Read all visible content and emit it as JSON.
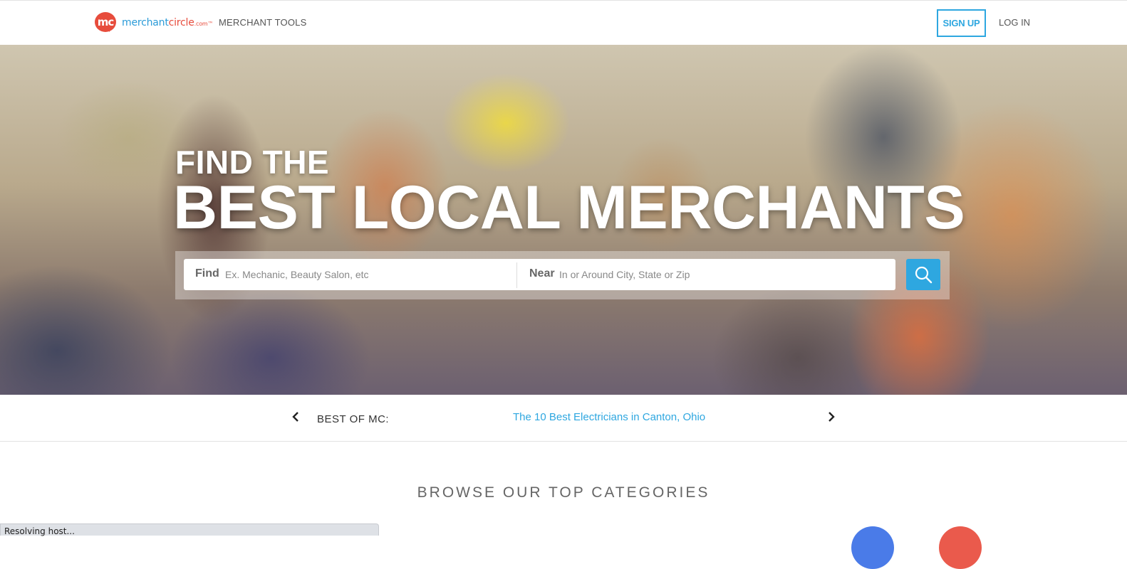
{
  "header": {
    "logo_badge": "mc",
    "logo_text_main": "merchant",
    "logo_text_accent": "circle",
    "logo_text_suffix": ".com™",
    "merchant_tools": "MERCHANT TOOLS",
    "sign_up": "SIGN UP",
    "log_in": "LOG IN"
  },
  "hero": {
    "title_small": "FIND THE",
    "title_big": "BEST LOCAL MERCHANTS",
    "find_label": "Find",
    "find_placeholder": "Ex. Mechanic, Beauty Salon, etc",
    "find_value": "",
    "near_label": "Near",
    "near_placeholder": "In or Around City, State or Zip",
    "near_value": "",
    "search_icon": "search-icon"
  },
  "best_of": {
    "label": "BEST OF MC:",
    "link": "The 10 Best Electricians in Canton, Ohio",
    "prev_icon": "chevron-left-icon",
    "next_icon": "chevron-right-icon"
  },
  "categories": {
    "heading": "BROWSE OUR TOP CATEGORIES"
  },
  "status_bar": {
    "text": "Resolving host..."
  },
  "colors": {
    "accent_blue": "#2ea7e0",
    "brand_red": "#e74c3c",
    "category_blue": "#4a7be8",
    "category_red": "#ea5a4c"
  }
}
